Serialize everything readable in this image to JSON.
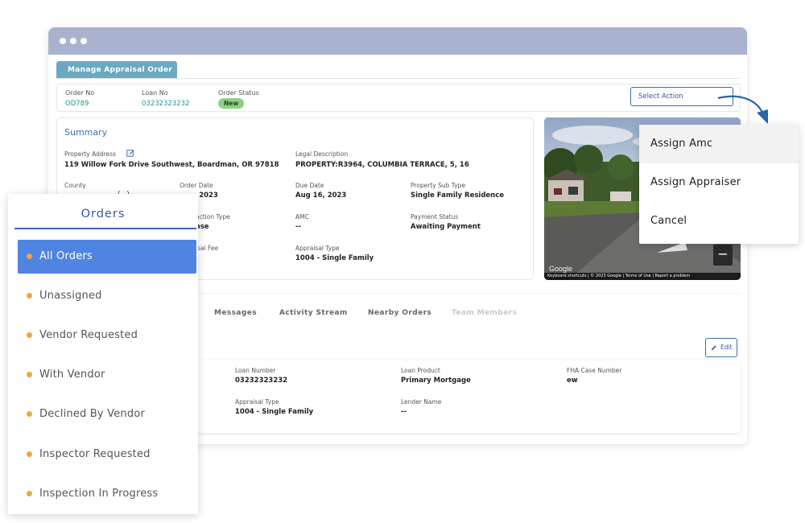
{
  "tab": {
    "label": "Manage Appraisal Order"
  },
  "order": {
    "order_no_label": "Order No",
    "order_no": "OD789",
    "loan_no_label": "Loan No",
    "loan_no": "03232323232",
    "status_label": "Order Status",
    "status": "New",
    "select_action": "Select Action"
  },
  "summary": {
    "title": "Summary",
    "property_address_label": "Property Address",
    "property_address": "119 Willow Fork Drive Southwest, Boardman, OR 97818",
    "legal_description_label": "Legal Description",
    "legal_description": "PROPERTY:R3964, COLUMBIA TERRACE, 5, 16",
    "county_label": "County",
    "county_value_fragment": "(...)",
    "order_date_label": "Order Date",
    "order_date_fragment": ", 2023",
    "due_date_label": "Due Date",
    "due_date": "Aug 16, 2023",
    "property_sub_type_label": "Property Sub Type",
    "property_sub_type": "Single Family Residence",
    "transaction_type_fragment_label": "action Type",
    "transaction_type_fragment": "ase",
    "amc_label": "AMC",
    "amc": "--",
    "payment_status_label": "Payment Status",
    "payment_status": "Awaiting Payment",
    "appraisal_fee_fragment_label": "isal Fee",
    "appraisal_type_label": "Appraisal Type",
    "appraisal_type": "1004 - Single Family"
  },
  "map": {
    "google": "Google",
    "footer": "Keyboard shortcuts | © 2023 Google | Terms of Use | Report a problem",
    "zoom_out": "−"
  },
  "lower_tabs": [
    "Messages",
    "Activity Stream",
    "Nearby Orders",
    "Team Members"
  ],
  "details": {
    "edit": "Edit",
    "loan_number_label": "Loan Number",
    "loan_number": "03232323232",
    "loan_product_label": "Loan Product",
    "loan_product": "Primary Mortgage",
    "fha_label": "FHA Case Number",
    "fha": "ew",
    "appraisal_type_label": "Appraisal Type",
    "appraisal_type": "1004 - Single Family",
    "lender_name_label": "Lender Name",
    "lender_name": "--"
  },
  "dropdown": {
    "items": [
      "Assign Amc",
      "Assign Appraiser",
      "Cancel"
    ]
  },
  "orders": {
    "title": "Orders",
    "items": [
      "All Orders",
      "Unassigned",
      "Vendor Requested",
      "With Vendor",
      "Declined By Vendor",
      "Inspector Requested",
      "Inspection In Progress"
    ]
  },
  "colors": {
    "accent": "#4f84e3",
    "tab": "#6aa9c0",
    "dot": "#f1a63a",
    "link": "#1a9c8f",
    "arrow": "#2a64a8"
  }
}
